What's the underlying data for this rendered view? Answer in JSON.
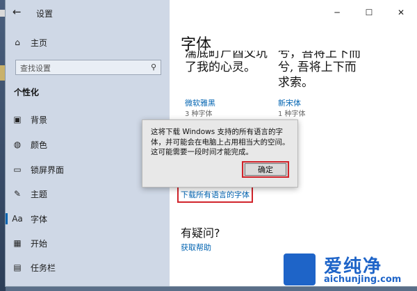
{
  "window": {
    "title": "设置"
  },
  "sidebar": {
    "home_label": "主页",
    "search_placeholder": "查找设置",
    "section": "个性化",
    "items": [
      {
        "label": "背景",
        "icon": "image-icon"
      },
      {
        "label": "颜色",
        "icon": "palette-icon"
      },
      {
        "label": "锁屏界面",
        "icon": "lock-screen-icon"
      },
      {
        "label": "主题",
        "icon": "theme-icon"
      },
      {
        "label": "字体",
        "icon": "font-icon",
        "active": true
      },
      {
        "label": "开始",
        "icon": "start-icon"
      },
      {
        "label": "任务栏",
        "icon": "taskbar-icon"
      }
    ]
  },
  "main": {
    "title": "字体",
    "previews": [
      {
        "line1": "濡底町尸酉父坑",
        "line2": "了我的心灵。",
        "name": "微软雅黑",
        "count": "3 种字体"
      },
      {
        "line1": "兮, 吾将上下而",
        "line2": "求索。",
        "name": "新宋体",
        "count": "1 种字体"
      }
    ],
    "download_link": "下载所有语言的字体",
    "question_heading": "有疑问?",
    "help_link": "获取帮助"
  },
  "dialog": {
    "message": "这将下载 Windows 支持的所有语言的字体，并可能会在电脑上占用相当大的空间。这可能需要一段时间才能完成。",
    "ok_label": "确定"
  },
  "watermark": {
    "text": "爱纯净",
    "url": "aichunjing.com"
  },
  "colors": {
    "accent": "#0063b1",
    "highlight": "#d1232a",
    "sidebar_bg": "#cfd8e6"
  }
}
